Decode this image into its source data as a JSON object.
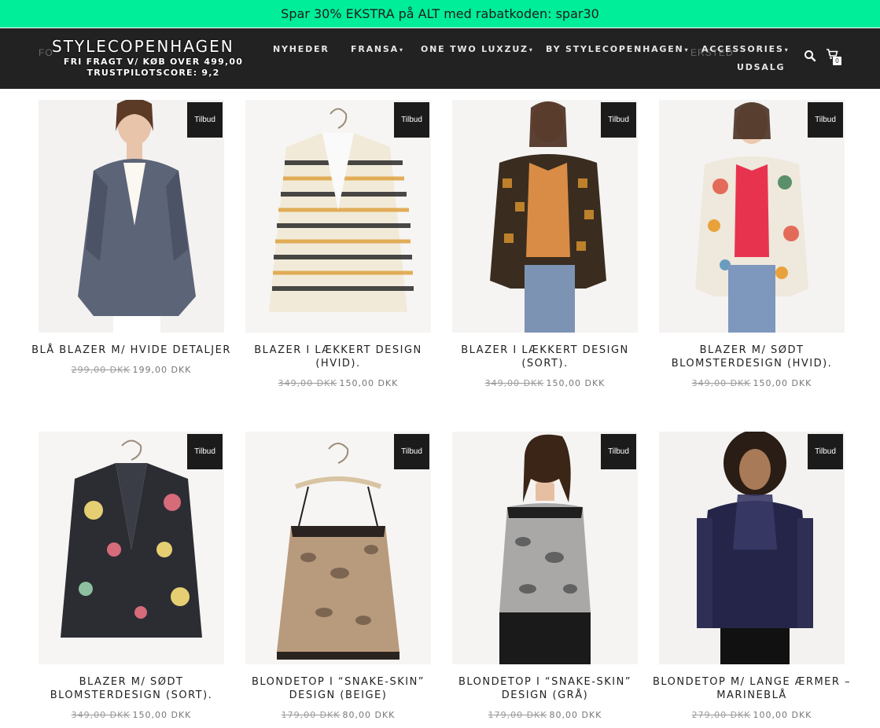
{
  "promo": {
    "text": "Spar 30% EKSTRA på ALT med rabatkoden: spar30"
  },
  "header": {
    "ghost_left": "FO",
    "ghost_right": "ERSTED",
    "brand": "STYLECOPENHAGEN",
    "shipping": "FRI FRAGT V/ KØB OVER 499,00",
    "trustpilot": "TRUSTPILOTSCORE: 9,2",
    "cart_count": "0",
    "colors": {
      "bar": "#222222",
      "promo": "#00ee9a"
    }
  },
  "menu": [
    {
      "label": "NYHEDER",
      "dropdown": false
    },
    {
      "label": "FRANSA",
      "dropdown": true
    },
    {
      "label": "ONE TWO LUXZUZ",
      "dropdown": true
    },
    {
      "label": "BY STYLECOPENHAGEN",
      "dropdown": true
    },
    {
      "label": "ACCESSORIES",
      "dropdown": true
    },
    {
      "label": "UDSALG",
      "dropdown": false
    }
  ],
  "products": [
    {
      "title": "BLÅ BLAZER M/ HVIDE DETALJER",
      "old_price": "299,00 DKK",
      "price": "199,00 DKK",
      "badge": "Tilbud"
    },
    {
      "title": "BLAZER I LÆKKERT DESIGN (HVID).",
      "old_price": "349,00 DKK",
      "price": "150,00 DKK",
      "badge": "Tilbud"
    },
    {
      "title": "BLAZER I LÆKKERT DESIGN (SORT).",
      "old_price": "349,00 DKK",
      "price": "150,00 DKK",
      "badge": "Tilbud"
    },
    {
      "title": "BLAZER M/ SØDT BLOMSTERDESIGN (HVID).",
      "old_price": "349,00 DKK",
      "price": "150,00 DKK",
      "badge": "Tilbud"
    },
    {
      "title": "BLAZER M/ SØDT BLOMSTERDESIGN (SORT).",
      "old_price": "349,00 DKK",
      "price": "150,00 DKK",
      "badge": "Tilbud"
    },
    {
      "title": "BLONDETOP I “SNAKE-SKIN” DESIGN (BEIGE)",
      "old_price": "179,00 DKK",
      "price": "80,00 DKK",
      "badge": "Tilbud"
    },
    {
      "title": "BLONDETOP I “SNAKE-SKIN” DESIGN (GRÅ)",
      "old_price": "179,00 DKK",
      "price": "80,00 DKK",
      "badge": "Tilbud"
    },
    {
      "title": "BLONDETOP M/ LANGE ÆRMER – MARINEBLÅ",
      "old_price": "279,00 DKK",
      "price": "100,00 DKK",
      "badge": "Tilbud"
    }
  ]
}
